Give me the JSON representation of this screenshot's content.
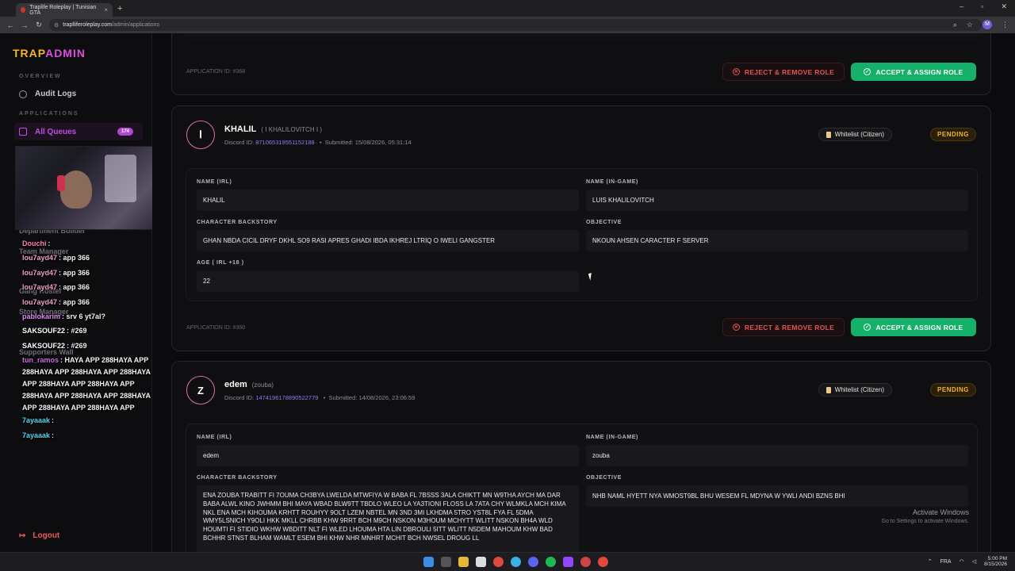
{
  "browser": {
    "tab_title": "Traplife Roleplay | Tunisian GTA",
    "url_host": "traplliferoleplay.com",
    "url_path": "/admin/applications",
    "profile_initial": "M"
  },
  "sidebar": {
    "logo_part1": "TRAP",
    "logo_part2": "ADMIN",
    "section_overview": "OVERVIEW",
    "audit_logs": "Audit Logs",
    "section_applications": "APPLICATIONS",
    "all_queues": "All Queues",
    "queue_count": "174",
    "hidden_items": [
      "Department Builder",
      "Team Manager",
      "Gang Roster",
      "Store Manager",
      "Supporters Wall"
    ],
    "logout": "Logout"
  },
  "chat": [
    {
      "user": "Douchi",
      "msg": ":",
      "color": "#ff7fb0"
    },
    {
      "user": "lou7ayd47",
      "msg": ": app 366",
      "color": "#f0a0c8"
    },
    {
      "user": "lou7ayd47",
      "msg": ": app 366",
      "color": "#f0a0c8"
    },
    {
      "user": "lou7ayd47",
      "msg": ": app 366",
      "color": "#f0a0c8"
    },
    {
      "user": "lou7ayd47",
      "msg": ": app 366",
      "color": "#f0a0c8"
    },
    {
      "user": "pablokarim",
      "msg": ": srv 6 yt7al?",
      "color": "#e08df0"
    },
    {
      "user": "SAKSOUF22",
      "msg": ": #269",
      "color": "#ffffff"
    },
    {
      "user": "SAKSOUF22",
      "msg": ": #269",
      "color": "#ffffff"
    },
    {
      "user": "tun_ramos",
      "msg": ": HAYA APP 288HAYA APP",
      "color": "#d06be0"
    },
    {
      "user": "",
      "msg": "288HAYA APP 288HAYA APP 288HAYA",
      "color": "#ffffff"
    },
    {
      "user": "",
      "msg": "APP 288HAYA APP 288HAYA APP",
      "color": "#ffffff"
    },
    {
      "user": "",
      "msg": "288HAYA APP 288HAYA APP 288HAYA",
      "color": "#ffffff"
    },
    {
      "user": "",
      "msg": "APP 288HAYA APP 288HAYA APP",
      "color": "#ffffff"
    },
    {
      "user": "7ayaaak",
      "msg": ":",
      "color": "#56d3f0"
    },
    {
      "user": "7ayaaak",
      "msg": ":",
      "color": "#56d3f0"
    }
  ],
  "labels": {
    "name_irl": "NAME (IRL)",
    "name_ingame": "NAME (IN-GAME)",
    "backstory": "CHARACTER BACKSTORY",
    "objective": "OBJECTIVE",
    "age": "AGE ( IRL +18 )",
    "reject": "REJECT & REMOVE ROLE",
    "accept": "ACCEPT & ASSIGN ROLE",
    "discord_id": "Discord ID:",
    "submitted": "Submitted:"
  },
  "top_card": {
    "app_id": "APPLICATION ID: #368"
  },
  "applications": [
    {
      "initial": "ꓲ",
      "name": "KHALIL",
      "alias": "( ꓲ KHALILOVITCH ꓲ )",
      "discord_id": "871065319551152188",
      "submitted": "15/08/2026, 05:31:14",
      "type": "Whitelist (Citizen)",
      "status": "PENDING",
      "name_irl": "KHALIL",
      "name_ingame": "LUIS KHALILOVITCH",
      "backstory": "GHAN NBDA CICIL DRYF DKHL SO9 RASI APRES GHADI IBDA IKHREJ LTRIQ O IWELI GANGSTER",
      "objective": "NKOUN AHSEN CARACTER F SERVER",
      "age": "22",
      "app_id": "APPLICATION ID: #360"
    },
    {
      "initial": "Z",
      "name": "edem",
      "alias": "(zouba)",
      "discord_id": "1474196178890522779",
      "submitted": "14/08/2026, 23:06:59",
      "type": "Whitelist (Citizen)",
      "status": "PENDING",
      "name_irl": "edem",
      "name_ingame": "zouba",
      "backstory": "ENA ZOUBA TRABITT FI 7OUMA CH3BYA LWELDA MTWFIYA W BABA FL 7BSSS 3ALA CHIKTT MN W9THA AYCH MA DAR BABA ALWL KINO JWHMM BHI MAYA  WBAD BLW9TT TBDLO WLEO LA YA3TIONI FLOSS LA 7ATA CHY WLMKLA MCH KIMA NKL ENA MCH KIHOUMA KRHTT ROUHYY 9OLT LZEM NBTEL MN 3ND 3MI LKHDMA 5TRO YST8L FYA FL 5DMA WMY5LSNICH Y9OLI HKK MKLL CHRBB KHW 9RRT BCH M9CH NSKON M3HOUM MCHYTT WLITT NSKON BH4A WLD HOUMTI FI STIDIO WKHW WBDITT NLT FI WLED LHOUMA HTA LIN DBROULI 5ITT WLITT N5DEM MAHOUM KHW BAD BCHHR STNST BLHAM WAMLT ESEM BHI KHW NHR MNHRT MCHIT BCH NWSEL DROUG LL",
      "objective": "NHB NAML HYETT NYA WMOST9BL BHU WESEM FL MDYNA W YWLI ANDI BZNS BHI"
    }
  ],
  "windows_watermark": {
    "title": "Activate Windows",
    "sub": "Go to Settings to activate Windows."
  },
  "taskbar": {
    "lang": "FRA",
    "time": "5:00 PM",
    "date": "8/15/2026"
  }
}
